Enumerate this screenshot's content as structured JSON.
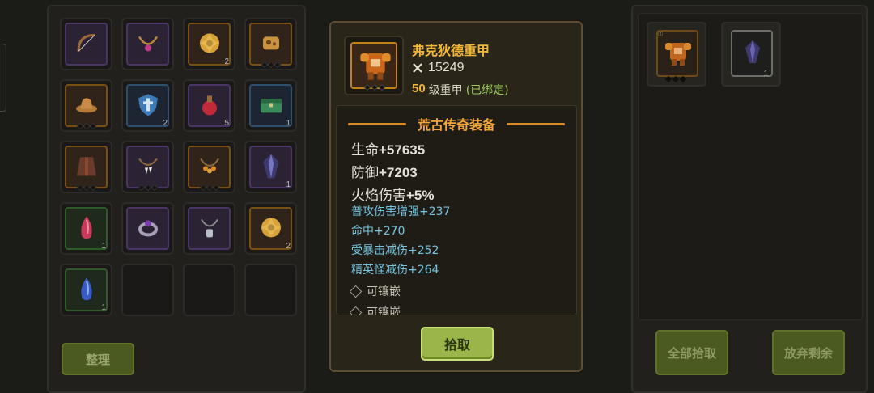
{
  "bag": {
    "slots": [
      {
        "icon": "bow-icon",
        "quality": "purple",
        "count": ""
      },
      {
        "icon": "necklace-icon",
        "quality": "purple",
        "count": ""
      },
      {
        "icon": "shuriken-icon",
        "quality": "orange",
        "count": "2"
      },
      {
        "icon": "fossil-icon",
        "quality": "orange",
        "count": ""
      },
      {
        "icon": "hat-icon",
        "quality": "orange",
        "count": ""
      },
      {
        "icon": "shield-icon",
        "quality": "blue",
        "count": "2"
      },
      {
        "icon": "potion-icon",
        "quality": "purple",
        "count": "5"
      },
      {
        "icon": "chest-icon",
        "quality": "blue",
        "count": "1"
      },
      {
        "icon": "robe-icon",
        "quality": "orange",
        "count": ""
      },
      {
        "icon": "fang-necklace-icon",
        "quality": "purple",
        "count": ""
      },
      {
        "icon": "amber-necklace-icon",
        "quality": "orange",
        "count": ""
      },
      {
        "icon": "crystal-icon",
        "quality": "purple",
        "count": "1"
      },
      {
        "icon": "ruby-icon",
        "quality": "green",
        "count": "1"
      },
      {
        "icon": "ring-icon",
        "quality": "purple",
        "count": ""
      },
      {
        "icon": "tag-necklace-icon",
        "quality": "purple",
        "count": ""
      },
      {
        "icon": "shuriken-icon",
        "quality": "orange",
        "count": "2"
      },
      {
        "icon": "sapphire-icon",
        "quality": "green",
        "count": "1"
      },
      {
        "icon": "",
        "quality": "empty",
        "count": ""
      },
      {
        "icon": "",
        "quality": "empty",
        "count": ""
      },
      {
        "icon": "",
        "quality": "empty",
        "count": ""
      }
    ],
    "sort_label": "整理"
  },
  "loot": {
    "items": [
      {
        "icon": "heavy-armor-icon",
        "quality": "orange",
        "count": ""
      },
      {
        "icon": "crystal-icon",
        "quality": "gray",
        "count": "1"
      }
    ],
    "pick_all_label": "全部拾取",
    "discard_label": "放弃剩余"
  },
  "tooltip": {
    "name": "弗克狄德重甲",
    "power": "15249",
    "level": "50",
    "type_label": "级重甲",
    "bound_label": "(已绑定)",
    "section_title": "荒古传奇装备",
    "main_stats": [
      {
        "label": "生命",
        "value": "+57635"
      },
      {
        "label": "防御",
        "value": "+7203"
      },
      {
        "label": "火焰伤害",
        "value": "+5%"
      }
    ],
    "sub_stats": [
      "普攻伤害增强+237",
      "命中+270",
      "受暴击减伤+252",
      "精英怪减伤+264"
    ],
    "sockets": [
      "可镶嵌",
      "可镶嵌"
    ],
    "pick_label": "拾取"
  },
  "colors": {
    "item_name": "#f2b73a",
    "sub_stat": "#74c4e0",
    "bound": "#9acb5a",
    "button_green": "#9ab549"
  }
}
